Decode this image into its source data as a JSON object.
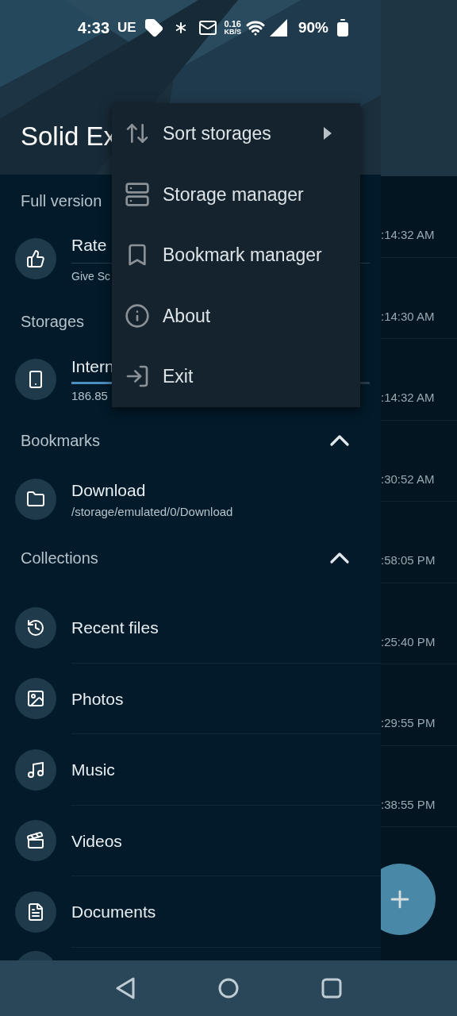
{
  "status_bar": {
    "time": "4:33",
    "carrier_badge": "UE",
    "net_speed": "0.16",
    "net_unit": "KB/S",
    "battery": "90%"
  },
  "drawer": {
    "title": "Solid Ex",
    "full_version": {
      "header": "Full version",
      "title": "Rate",
      "subtitle": "Give Sc"
    },
    "storages": {
      "header": "Storages",
      "name": "Intern",
      "level": 0.5,
      "info": "186.85"
    },
    "bookmarks": {
      "header": "Bookmarks",
      "expanded": true,
      "items": [
        {
          "name": "Download",
          "path": "/storage/emulated/0/Download"
        }
      ]
    },
    "collections": {
      "header": "Collections",
      "expanded": true,
      "items": [
        {
          "kind": "recent",
          "label": "Recent files"
        },
        {
          "kind": "photos",
          "label": "Photos"
        },
        {
          "kind": "music",
          "label": "Music"
        },
        {
          "kind": "videos",
          "label": "Videos"
        },
        {
          "kind": "documents",
          "label": "Documents"
        }
      ]
    }
  },
  "background_list": {
    "times": [
      ":14:32 AM",
      ":14:30 AM",
      ":14:32 AM",
      ":30:52 AM",
      ":58:05 PM",
      ":25:40 PM",
      ":29:55 PM",
      ":38:55 PM"
    ]
  },
  "menu": {
    "items": [
      {
        "kind": "sort",
        "label": "Sort storages",
        "has_submenu": true
      },
      {
        "kind": "storage",
        "label": "Storage manager",
        "has_submenu": false
      },
      {
        "kind": "bookmark",
        "label": "Bookmark manager",
        "has_submenu": false
      },
      {
        "kind": "about",
        "label": "About",
        "has_submenu": false
      },
      {
        "kind": "exit",
        "label": "Exit",
        "has_submenu": false
      }
    ]
  }
}
